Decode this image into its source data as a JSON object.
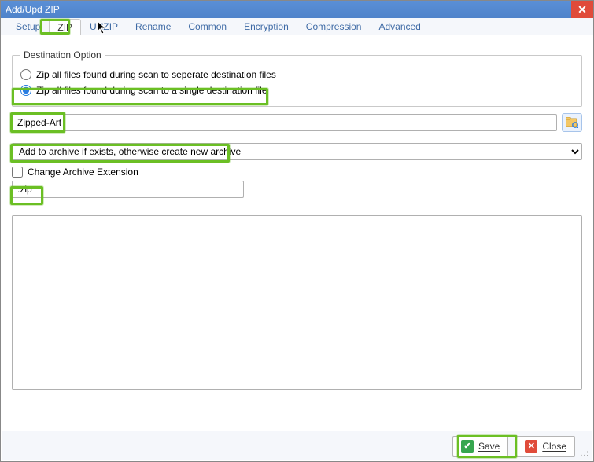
{
  "window": {
    "title": "Add/Upd ZIP"
  },
  "tabs": {
    "items": [
      "Setup",
      "ZIP",
      "UNZIP",
      "Rename",
      "Common",
      "Encryption",
      "Compression",
      "Advanced"
    ],
    "active_index": 1
  },
  "dest": {
    "legend": "Destination Option",
    "opt_separate": "Zip all files found during scan to seperate destination files",
    "opt_single": "Zip all files found during scan to a single destination file",
    "selected": "single"
  },
  "archive": {
    "name_value": "Zipped-Art",
    "browse_icon": "browse-folder-icon"
  },
  "mode": {
    "selected_label": "Add to archive if exists, otherwise create new archive"
  },
  "extension": {
    "checkbox_label": "Change Archive Extension",
    "checked": false,
    "value": ".zip"
  },
  "buttons": {
    "save": "Save",
    "close": "Close"
  }
}
